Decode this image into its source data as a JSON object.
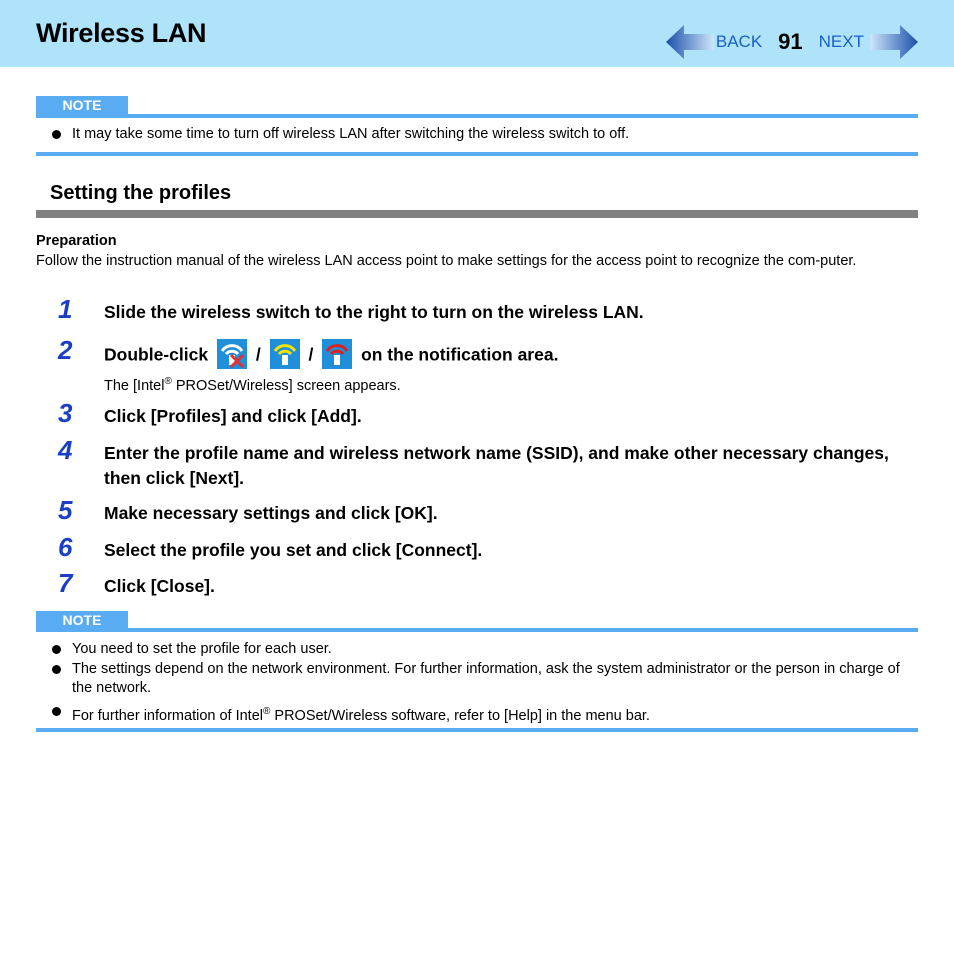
{
  "header": {
    "title": "Wireless LAN",
    "back_label": "BACK",
    "page_number": "91",
    "next_label": "NEXT"
  },
  "note1": {
    "label": "NOTE",
    "items": [
      "It may take some time to turn off wireless LAN after switching the wireless switch to off."
    ]
  },
  "section": {
    "title": "Setting the profiles",
    "prep_title": "Preparation",
    "prep_text": "Follow the instruction manual of the wireless LAN access point to make settings for the access point to recognize the com-puter."
  },
  "steps": [
    {
      "num": "1",
      "text": "Slide the wireless switch to the right to turn on the wireless LAN."
    },
    {
      "num": "2",
      "prefix": "Double-click",
      "sep": "/",
      "suffix": "on the notification area.",
      "sub_pre": "The [Intel",
      "sub_sup": "®",
      "sub_post": " PROSet/Wireless] screen appears.",
      "icons": [
        "wireless-off-icon",
        "wireless-yellow-icon",
        "wireless-red-icon"
      ]
    },
    {
      "num": "3",
      "text": "Click [Profiles] and click [Add]."
    },
    {
      "num": "4",
      "text": "Enter the profile name and wireless network name (SSID), and make other necessary changes, then click [Next]."
    },
    {
      "num": "5",
      "text": "Make necessary settings and click [OK]."
    },
    {
      "num": "6",
      "text": "Select the profile you set and click [Connect]."
    },
    {
      "num": "7",
      "text": "Click [Close]."
    }
  ],
  "note2": {
    "label": "NOTE",
    "items": [
      "You need to set the profile for each user.",
      "The settings depend on the network environment. For further information, ask the system administrator or the person in charge of the network."
    ],
    "item3_pre": "For further information of Intel",
    "item3_sup": "®",
    "item3_post": " PROSet/Wireless software, refer to [Help] in the menu bar."
  }
}
